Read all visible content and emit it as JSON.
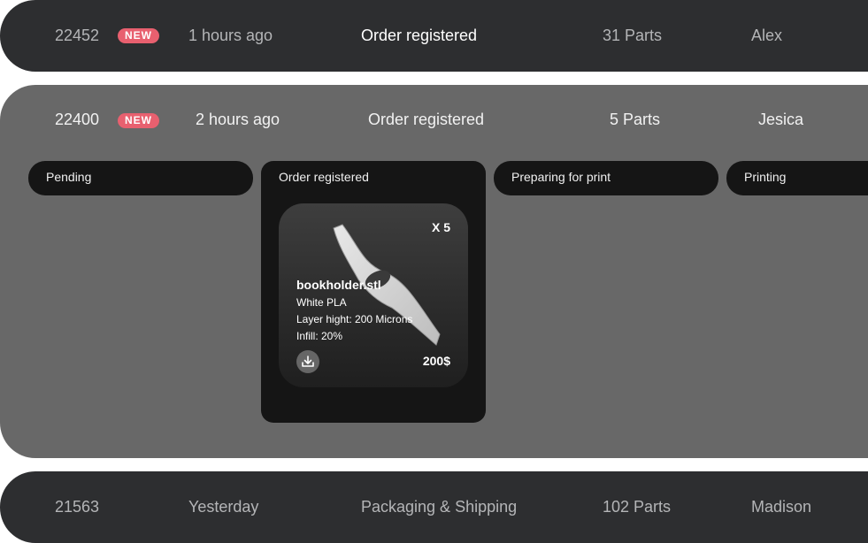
{
  "orders": [
    {
      "id": "22452",
      "badge": "NEW",
      "time": "1 hours ago",
      "status": "Order registered",
      "parts": "31 Parts",
      "customer": "Alex"
    },
    {
      "id": "22400",
      "badge": "NEW",
      "time": "2 hours ago",
      "status": "Order registered",
      "parts": "5 Parts",
      "customer": "Jesica",
      "stages": [
        "Pending",
        "Order registered",
        "Preparing for print",
        "Printing"
      ],
      "part_card": {
        "quantity": "X 5",
        "filename": "bookholder.stl",
        "material": "White PLA",
        "layer_height": "Layer hight: 200 Microns",
        "infill": "Infill: 20%",
        "price": "200$",
        "download_icon": "download-icon"
      }
    },
    {
      "id": "21563",
      "time": "Yesterday",
      "status": "Packaging & Shipping",
      "parts": "102 Parts",
      "customer": "Madison"
    }
  ],
  "colors": {
    "badge": "#e8606f",
    "row_dark": "#2d2e30",
    "row_expanded": "#686868",
    "stage": "#151515"
  }
}
